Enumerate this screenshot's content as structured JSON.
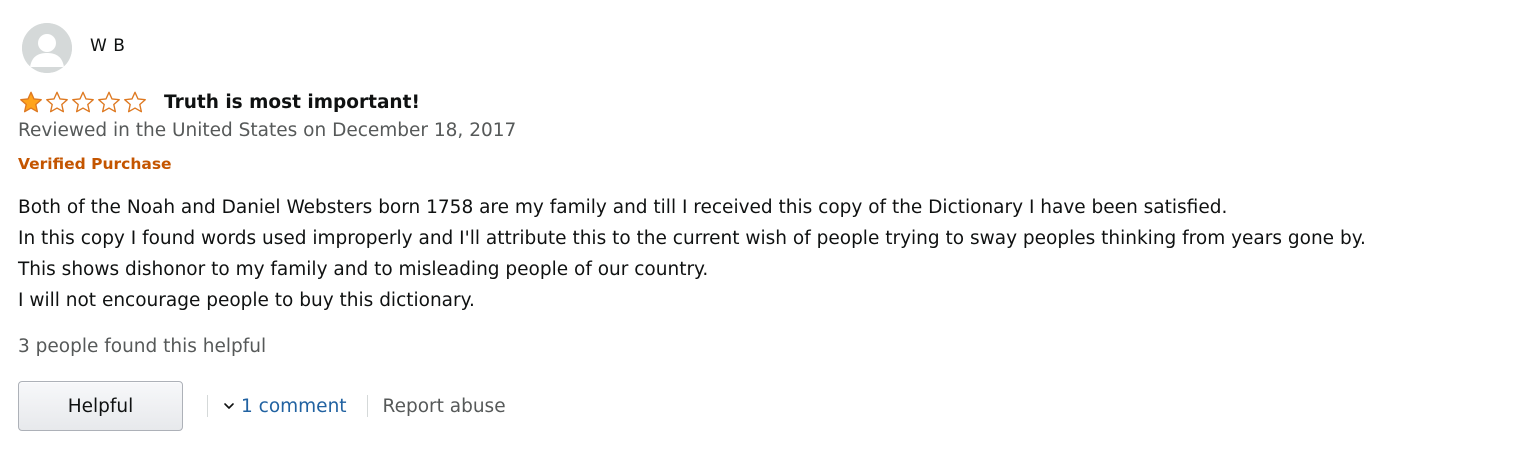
{
  "reviewer": {
    "name": "W B",
    "avatar_icon": "user-silhouette-icon"
  },
  "rating": {
    "value": 1,
    "max": 5,
    "filled_color": "#ffa41c",
    "star_outline_color": "#de7921"
  },
  "review": {
    "title": "Truth is most important!",
    "date_line": "Reviewed in the United States on December 18, 2017",
    "verified_label": "Verified Purchase",
    "body_lines": [
      "Both of the Noah and Daniel Websters born 1758 are my family and till I received this copy of the Dictionary I have been satisfied.",
      "In this copy I found words used improperly and I'll attribute this to the current wish of people trying to sway peoples thinking from years gone by.",
      "This shows dishonor to my family and to misleading people of our country.",
      "I will not encourage people to buy this dictionary."
    ]
  },
  "helpful_count_text": "3 people found this helpful",
  "actions": {
    "helpful_button_label": "Helpful",
    "comments_link_label": "1 comment",
    "report_link_label": "Report abuse"
  },
  "colors": {
    "verified": "#c45500",
    "link": "#2162a1",
    "secondary_text": "#565959"
  }
}
